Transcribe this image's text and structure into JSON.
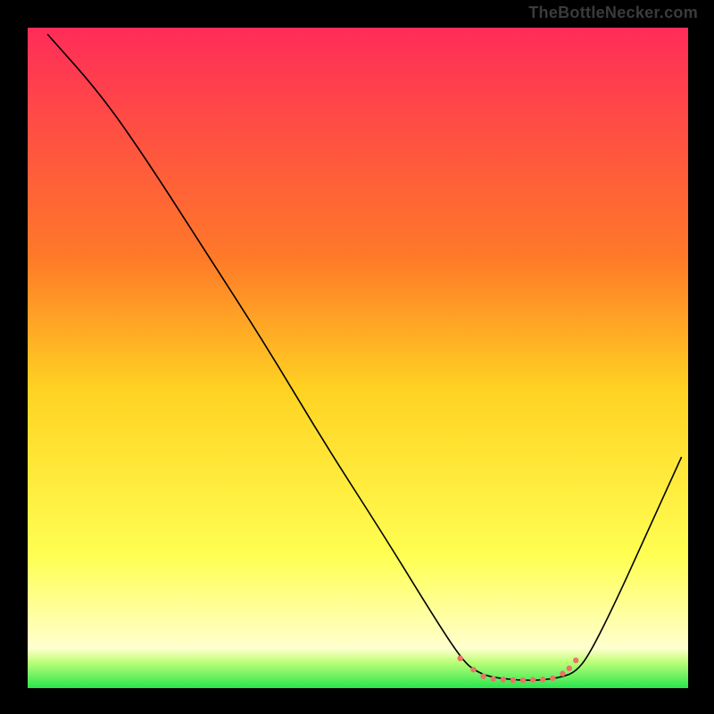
{
  "watermark": "TheBottleNecker.com",
  "chart_data": {
    "type": "line",
    "title": "",
    "xlabel": "",
    "ylabel": "",
    "xlim": [
      0,
      100
    ],
    "ylim": [
      0,
      100
    ],
    "gradient_stops": [
      {
        "offset": 0.0,
        "color": "#ff2c59"
      },
      {
        "offset": 0.35,
        "color": "#ff7a28"
      },
      {
        "offset": 0.55,
        "color": "#ffd322"
      },
      {
        "offset": 0.8,
        "color": "#ffff52"
      },
      {
        "offset": 0.94,
        "color": "#ffffcf"
      },
      {
        "offset": 0.96,
        "color": "#bfff7a"
      },
      {
        "offset": 1.0,
        "color": "#29e64d"
      }
    ],
    "series": [
      {
        "name": "curve",
        "type": "line",
        "color": "#000000",
        "points": [
          {
            "x": 3,
            "y": 99
          },
          {
            "x": 11,
            "y": 90
          },
          {
            "x": 18,
            "y": 80
          },
          {
            "x": 27,
            "y": 66
          },
          {
            "x": 36,
            "y": 52
          },
          {
            "x": 45,
            "y": 37
          },
          {
            "x": 54,
            "y": 23
          },
          {
            "x": 62,
            "y": 10
          },
          {
            "x": 66,
            "y": 4
          },
          {
            "x": 68,
            "y": 2.5
          },
          {
            "x": 70,
            "y": 1.7
          },
          {
            "x": 74,
            "y": 1.2
          },
          {
            "x": 78,
            "y": 1.2
          },
          {
            "x": 81,
            "y": 1.7
          },
          {
            "x": 83,
            "y": 2.5
          },
          {
            "x": 85,
            "y": 5
          },
          {
            "x": 89,
            "y": 13
          },
          {
            "x": 94,
            "y": 24
          },
          {
            "x": 99,
            "y": 35
          }
        ]
      },
      {
        "name": "bottom-dots",
        "type": "scatter",
        "color": "#e87566",
        "size": 3.2,
        "points": [
          {
            "x": 65.5,
            "y": 4.5
          },
          {
            "x": 67.5,
            "y": 2.8
          },
          {
            "x": 69.0,
            "y": 1.8
          },
          {
            "x": 70.5,
            "y": 1.4
          },
          {
            "x": 72.0,
            "y": 1.3
          },
          {
            "x": 73.5,
            "y": 1.2
          },
          {
            "x": 75.0,
            "y": 1.2
          },
          {
            "x": 76.5,
            "y": 1.25
          },
          {
            "x": 78.0,
            "y": 1.3
          },
          {
            "x": 79.5,
            "y": 1.5
          },
          {
            "x": 81.0,
            "y": 2.2
          },
          {
            "x": 82.0,
            "y": 3.0
          },
          {
            "x": 83.0,
            "y": 4.2
          }
        ]
      }
    ]
  }
}
